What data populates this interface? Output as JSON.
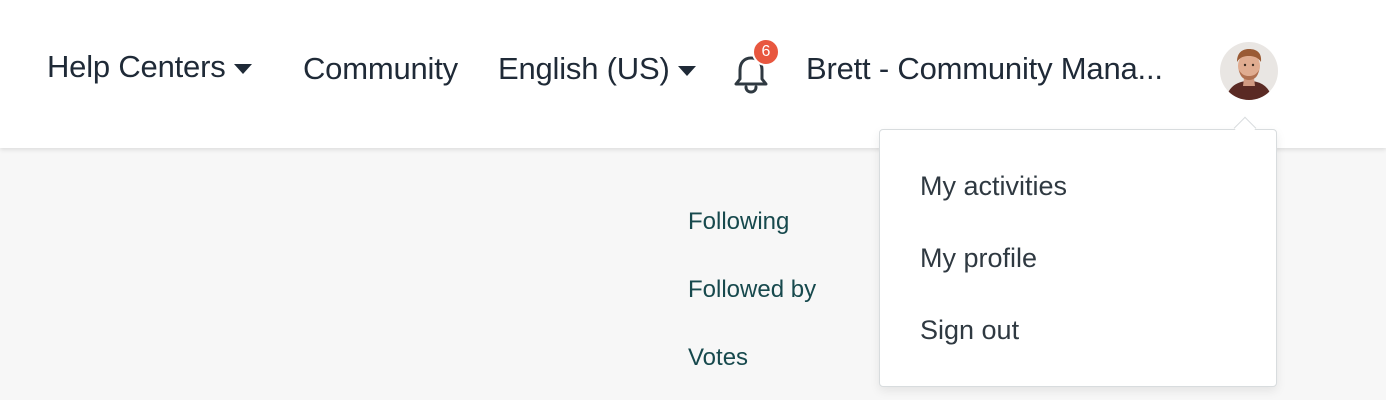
{
  "header": {
    "help_centers_label": "Help Centers",
    "community_label": "Community",
    "language_label": "English (US)",
    "notification_count": "6",
    "user_name": "Brett - Community Mana..."
  },
  "side_links": [
    "Following",
    "Followed by",
    "Votes"
  ],
  "user_menu": {
    "items": [
      "My activities",
      "My profile",
      "Sign out"
    ]
  },
  "colors": {
    "header_bg": "#ffffff",
    "page_bg": "#f7f7f7",
    "nav_text": "#1f2a37",
    "link_text": "#17494d",
    "badge": "#e8573f"
  },
  "icons": [
    "caret-down-icon",
    "bell-icon",
    "avatar"
  ]
}
